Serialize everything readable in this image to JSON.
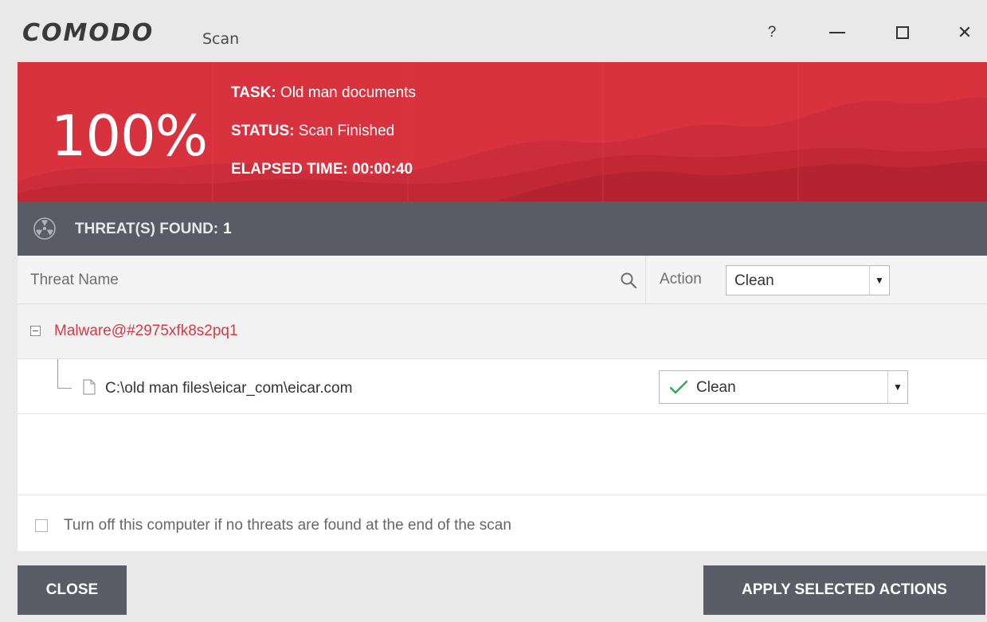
{
  "window": {
    "brand": "COMODO",
    "title": "Scan",
    "help_label": "?",
    "close_label": "✕"
  },
  "banner": {
    "percent": "100%",
    "task_label": "TASK:",
    "task_value": "Old man documents",
    "status_label": "STATUS:",
    "status_value": "Scan Finished",
    "elapsed_label": "ELAPSED TIME:",
    "elapsed_value": "00:00:40",
    "progress": 1.0,
    "color": "#d9323f"
  },
  "threats": {
    "label": "THREAT(S) FOUND:",
    "count": "1",
    "icon": "radiation-icon"
  },
  "table": {
    "col_name": "Threat Name",
    "col_action": "Action",
    "header_action_value": "Clean",
    "groups": [
      {
        "name": "Malware@#2975xfk8s2pq1",
        "files": [
          {
            "path": "C:\\old man files\\eicar_com\\eicar.com",
            "action": "Clean"
          }
        ]
      }
    ]
  },
  "options": {
    "shutdown_label": "Turn off this computer if no threats are found at the end of the scan",
    "shutdown_checked": false
  },
  "buttons": {
    "close": "CLOSE",
    "apply": "APPLY SELECTED ACTIONS"
  },
  "colors": {
    "accent_red": "#d9323f",
    "threat_red": "#d13b47",
    "dark_bar": "#595b66",
    "check_green": "#2fa84f"
  }
}
